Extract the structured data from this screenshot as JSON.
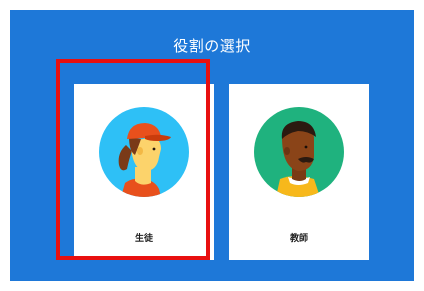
{
  "dialog": {
    "title": "役割の選択"
  },
  "roles": [
    {
      "label": "生徒",
      "selected": true
    },
    {
      "label": "教師",
      "selected": false
    }
  ],
  "colors": {
    "background": "#1e78d8",
    "card": "#ffffff",
    "selection_border": "#e81010",
    "student_avatar_bg": "#2ec0f6",
    "teacher_avatar_bg": "#1fb27e"
  },
  "icons": {
    "student": "student-avatar-icon",
    "teacher": "teacher-avatar-icon"
  }
}
